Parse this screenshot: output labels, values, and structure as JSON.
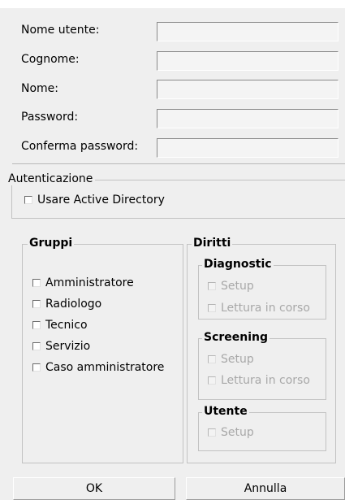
{
  "user_form": {
    "username": {
      "label": "Nome utente:",
      "value": ""
    },
    "surname": {
      "label": "Cognome:",
      "value": ""
    },
    "first_name": {
      "label": "Nome:",
      "value": ""
    },
    "password": {
      "label": "Password:",
      "value": ""
    },
    "confirm_password": {
      "label": "Conferma password:",
      "value": ""
    }
  },
  "authentication": {
    "title": "Autenticazione",
    "use_active_directory": {
      "label": "Usare Active Directory",
      "checked": false
    }
  },
  "groups": {
    "title": "Gruppi",
    "items": [
      {
        "label": "Amministratore",
        "checked": false
      },
      {
        "label": "Radiologo",
        "checked": false
      },
      {
        "label": "Tecnico",
        "checked": false
      },
      {
        "label": "Servizio",
        "checked": false
      },
      {
        "label": "Caso amministratore",
        "checked": false
      }
    ]
  },
  "rights": {
    "title": "Diritti",
    "diagnostic": {
      "title": "Diagnostic",
      "setup": "Setup",
      "reading": "Lettura in corso"
    },
    "screening": {
      "title": "Screening",
      "setup": "Setup",
      "reading": "Lettura in corso"
    },
    "user": {
      "title": "Utente",
      "setup": "Setup"
    }
  },
  "buttons": {
    "ok": "OK",
    "cancel": "Annulla"
  }
}
